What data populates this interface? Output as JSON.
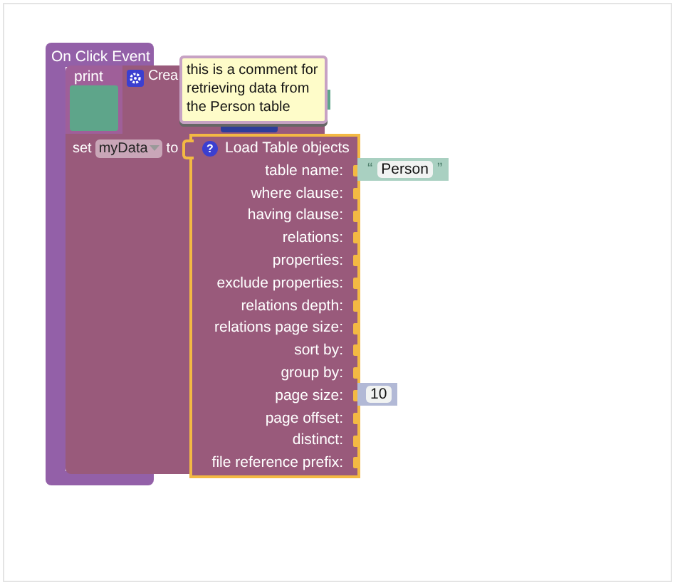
{
  "event": {
    "title": "On Click Event"
  },
  "print_block": {
    "label": "print"
  },
  "create_block": {
    "label": "Crea"
  },
  "comment": {
    "text": "this is a comment for retrieving data from the Person table"
  },
  "set_block": {
    "label": "set",
    "variable": "myData",
    "connector": "to"
  },
  "load_block": {
    "help": "?",
    "title": "Load Table objects",
    "fields": [
      {
        "label": "table name:",
        "input": {
          "kind": "text",
          "open_quote": "“",
          "value": "Person",
          "close_quote": "”"
        }
      },
      {
        "label": "where clause:"
      },
      {
        "label": "having clause:"
      },
      {
        "label": "relations:"
      },
      {
        "label": "properties:"
      },
      {
        "label": "exclude properties:"
      },
      {
        "label": "relations depth:"
      },
      {
        "label": "relations page size:"
      },
      {
        "label": "sort by:"
      },
      {
        "label": "group by:"
      },
      {
        "label": "page size:",
        "input": {
          "kind": "number",
          "value": "10"
        }
      },
      {
        "label": "page offset:"
      },
      {
        "label": "distinct:"
      },
      {
        "label": "file reference prefix:"
      }
    ]
  }
}
